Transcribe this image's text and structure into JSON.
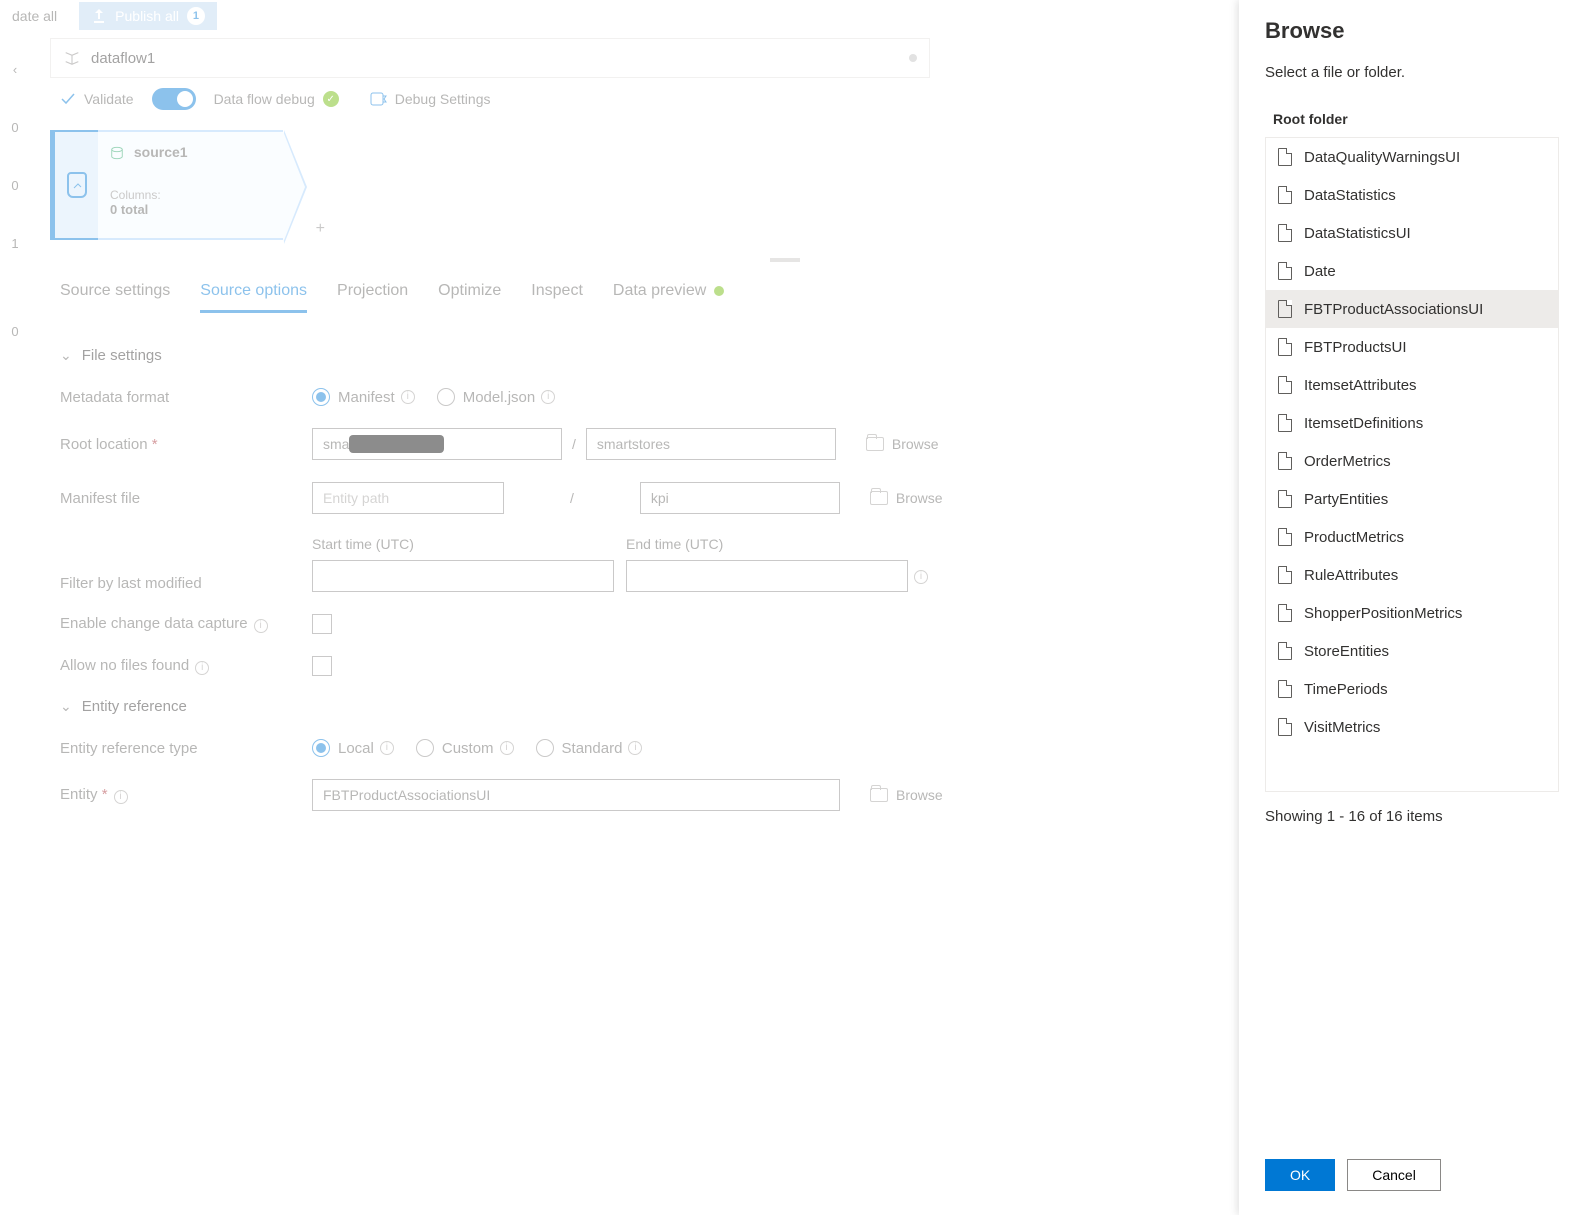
{
  "top": {
    "validate_all": "date all",
    "publish": "Publish all",
    "publish_count": "1"
  },
  "rail": [
    "0",
    "0",
    "1",
    "0"
  ],
  "tab": {
    "name": "dataflow1"
  },
  "toolbar": {
    "validate": "Validate",
    "debug": "Data flow debug",
    "debug_settings": "Debug Settings"
  },
  "node": {
    "title": "source1",
    "cols_label": "Columns:",
    "cols_total": "0 total"
  },
  "subtabs": [
    "Source settings",
    "Source options",
    "Projection",
    "Optimize",
    "Inspect",
    "Data preview"
  ],
  "active_subtab": 1,
  "sections": {
    "file_settings": "File settings",
    "entity_reference": "Entity reference"
  },
  "labels": {
    "metadata": "Metadata format",
    "root": "Root location",
    "manifest": "Manifest file",
    "filter": "Filter by last modified",
    "cdc": "Enable change data capture",
    "allow": "Allow no files found",
    "reftype": "Entity reference type",
    "entity": "Entity",
    "start": "Start time (UTC)",
    "end": "End time (UTC)",
    "browse": "Browse"
  },
  "radios": {
    "manifest": "Manifest",
    "modeljson": "Model.json",
    "local": "Local",
    "custom": "Custom",
    "standard": "Standard"
  },
  "values": {
    "root1_prefix": "sma",
    "root2": "smartstores",
    "entity_path_ph": "Entity path",
    "manifest2": "kpi",
    "entity": "FBTProductAssociationsUI"
  },
  "panel": {
    "title": "Browse",
    "subtitle": "Select a file or folder.",
    "breadcrumb": "Root folder",
    "count": "Showing 1 - 16 of 16 items",
    "ok": "OK",
    "cancel": "Cancel",
    "items": [
      "DataQualityWarningsUI",
      "DataStatistics",
      "DataStatisticsUI",
      "Date",
      "FBTProductAssociationsUI",
      "FBTProductsUI",
      "ItemsetAttributes",
      "ItemsetDefinitions",
      "OrderMetrics",
      "PartyEntities",
      "ProductMetrics",
      "RuleAttributes",
      "ShopperPositionMetrics",
      "StoreEntities",
      "TimePeriods",
      "VisitMetrics"
    ],
    "selected": 4
  }
}
